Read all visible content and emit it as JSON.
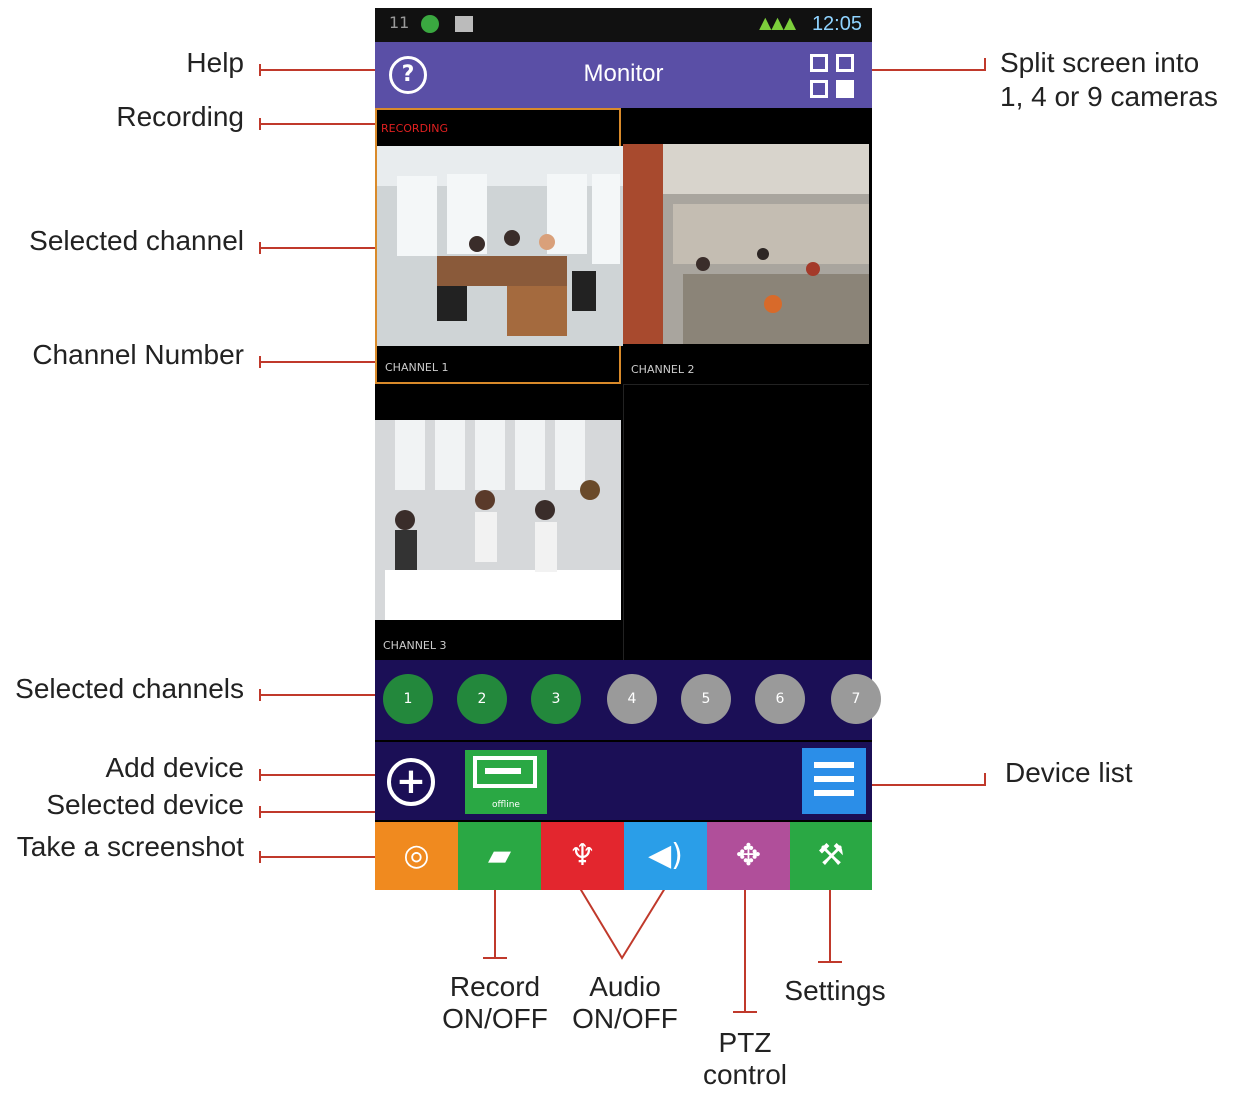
{
  "app": {
    "title": "Monitor",
    "status_bar": {
      "time": "12:05",
      "left_number": "11"
    },
    "help_glyph": "?",
    "recording_text": "RECORDING",
    "channels": [
      {
        "label": "CHANNEL 1",
        "selected": true
      },
      {
        "label": "CHANNEL 2",
        "selected": false
      },
      {
        "label": "CHANNEL 3",
        "selected": false
      }
    ],
    "channel_buttons": [
      {
        "number": "1",
        "active": true
      },
      {
        "number": "2",
        "active": true
      },
      {
        "number": "3",
        "active": true
      },
      {
        "number": "4",
        "active": false
      },
      {
        "number": "5",
        "active": false
      },
      {
        "number": "6",
        "active": false
      },
      {
        "number": "7",
        "active": false
      }
    ],
    "device": {
      "status": "offline"
    },
    "toolbar": [
      {
        "name": "screenshot",
        "icon": "camera-icon",
        "color": "#f08a1f"
      },
      {
        "name": "record",
        "icon": "cctv-icon",
        "color": "#2aa844"
      },
      {
        "name": "microphone",
        "icon": "microphone-icon",
        "color": "#e3262e"
      },
      {
        "name": "speaker",
        "icon": "speaker-icon",
        "color": "#2a9ee8"
      },
      {
        "name": "ptz",
        "icon": "ptz-arrows-icon",
        "color": "#b04f9a"
      },
      {
        "name": "settings",
        "icon": "toolbox-icon",
        "color": "#2aa844"
      }
    ]
  },
  "annotations": {
    "help": "Help",
    "recording": "Recording",
    "selected_channel": "Selected channel",
    "channel_number": "Channel Number",
    "selected_channels": "Selected channels",
    "add_device": "Add device",
    "selected_device": "Selected device",
    "take_screenshot": "Take a screenshot",
    "split_screen_1": "Split screen into",
    "split_screen_2": "1, 4 or 9 cameras",
    "device_list": "Device list",
    "record_1": "Record",
    "record_2": "ON/OFF",
    "audio_1": "Audio",
    "audio_2": "ON/OFF",
    "ptz_1": "PTZ",
    "ptz_2": "control",
    "settings": "Settings"
  },
  "colors": {
    "annotation_line": "#c0392b",
    "app_bar": "#5a4fa6",
    "control_bar": "#1b0f56",
    "selected_border": "#d98a2a"
  }
}
